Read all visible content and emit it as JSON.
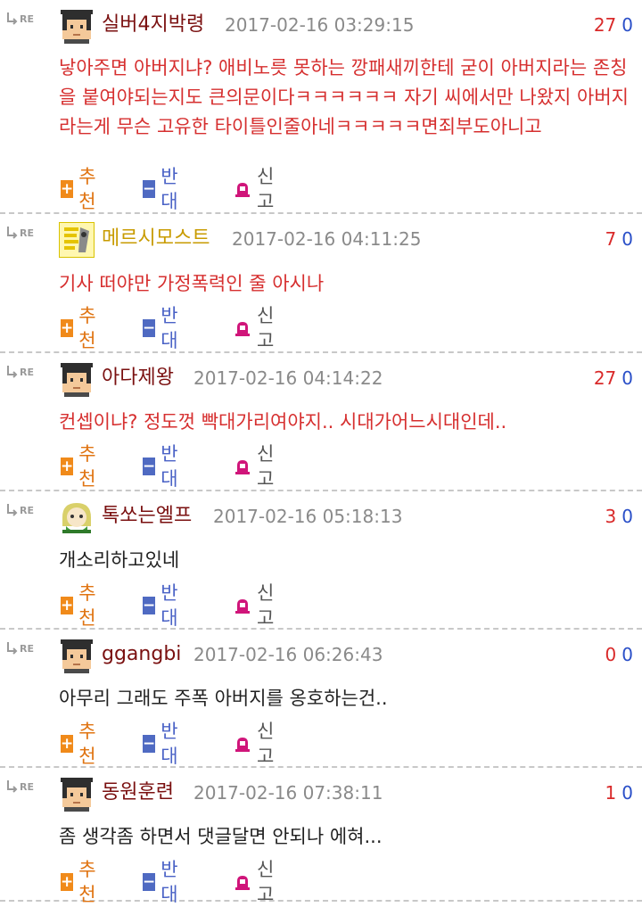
{
  "colors": {
    "body_red": "#d62f2f",
    "body_black": "#222222",
    "recommend_orange": "#f08a1a",
    "oppose_blue": "#4f6ac2",
    "report_pink": "#d0157a",
    "nick_dark_red": "#7a1010",
    "nick_gold": "#c89b00"
  },
  "labels": {
    "re": "RE",
    "recommend": "추천",
    "oppose": "반대",
    "report": "신고",
    "recommend_icon": "+",
    "oppose_icon": "−"
  },
  "comments": [
    {
      "nickname": "실버4지박령",
      "nickname_color": "#7a1010",
      "avatar": "pixel-face-icon",
      "date": "2017-02-16 03:29:15",
      "up": "27",
      "down": "0",
      "text": "낳아주면 아버지냐? 애비노릇 못하는 깡패새끼한테 굳이 아버지라는 존칭을 붙여야되는지도 큰의문이다ㅋㅋㅋㅋㅋㅋ 자기 씨에서만 나왔지 아버지라는게 무슨 고유한 타이틀인줄아네ㅋㅋㅋㅋㅋ면죄부도아니고",
      "text_color": "#d62f2f"
    },
    {
      "nickname": "메르시모스트",
      "nickname_color": "#c89b00",
      "avatar": "yellow-character-icon",
      "date": "2017-02-16 04:11:25",
      "up": "7",
      "down": "0",
      "text": "기사 떠야만 가정폭력인 줄 아시나",
      "text_color": "#d62f2f"
    },
    {
      "nickname": "아다제왕",
      "nickname_color": "#7a1010",
      "avatar": "pixel-face-icon",
      "date": "2017-02-16 04:14:22",
      "up": "27",
      "down": "0",
      "text": "컨셉이냐? 정도껏 빡대가리여야지.. 시대가어느시대인데..",
      "text_color": "#d62f2f"
    },
    {
      "nickname": "톡쏘는엘프",
      "nickname_color": "#7a1010",
      "avatar": "green-elf-icon",
      "date": "2017-02-16 05:18:13",
      "up": "3",
      "down": "0",
      "text": "개소리하고있네",
      "text_color": "#222222"
    },
    {
      "nickname": "ggangbi",
      "nickname_color": "#7a1010",
      "avatar": "pixel-face-icon",
      "date": "2017-02-16 06:26:43",
      "up": "0",
      "down": "0",
      "text": "아무리 그래도 주폭 아버지를 옹호하는건..",
      "text_color": "#222222"
    },
    {
      "nickname": "동원훈련",
      "nickname_color": "#7a1010",
      "avatar": "pixel-face-icon",
      "date": "2017-02-16 07:38:11",
      "up": "1",
      "down": "0",
      "text": "좀 생각좀 하면서 댓글달면 안되나 에혀...",
      "text_color": "#222222"
    }
  ]
}
